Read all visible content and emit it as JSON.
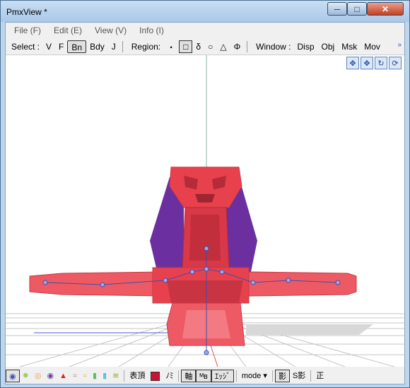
{
  "window": {
    "title": "PmxView *",
    "min_glyph": "─",
    "max_glyph": "□",
    "close_glyph": "✕"
  },
  "menu": [
    "File (F)",
    "Edit (E)",
    "View (V)",
    "Info (I)"
  ],
  "select": {
    "label": "Select :",
    "items": [
      "V",
      "F",
      "Bn",
      "Bdy",
      "J"
    ],
    "active": "Bn"
  },
  "region": {
    "label": "Region:",
    "items": [
      "・",
      "□",
      "δ",
      "○",
      "△",
      "Φ"
    ],
    "active": "□"
  },
  "window_group": {
    "label": "Window :",
    "items": [
      "Disp",
      "Obj",
      "Msk",
      "Mov"
    ]
  },
  "more_glyph": "»",
  "viewport_icons": [
    "move-xy-icon",
    "move-xz-icon",
    "rotate-icon",
    "reset-icon"
  ],
  "viewport_icon_glyphs": [
    "✥",
    "✥",
    "↻",
    "⟳"
  ],
  "status": {
    "icon_glyphs": [
      "◉",
      "✹",
      "◎",
      "◉",
      "▲",
      "≈",
      "≈",
      "▮",
      "▮",
      "≋"
    ],
    "hyoucho": "表頂",
    "color_swatch": "#cc1133",
    "nomi": "ﾉﾐ",
    "jiku": "軸",
    "mb": "ᴹʙ",
    "edge": "ｴｯｼﾞ",
    "mode": "mode ▾",
    "kage": "影",
    "skage": "S影",
    "sei": "正"
  },
  "colors": {
    "body_red": "#e8414e",
    "wing_purple": "#6b2fa0",
    "bone_blue": "#3c4fb0",
    "grid": "#bdbdbd"
  }
}
